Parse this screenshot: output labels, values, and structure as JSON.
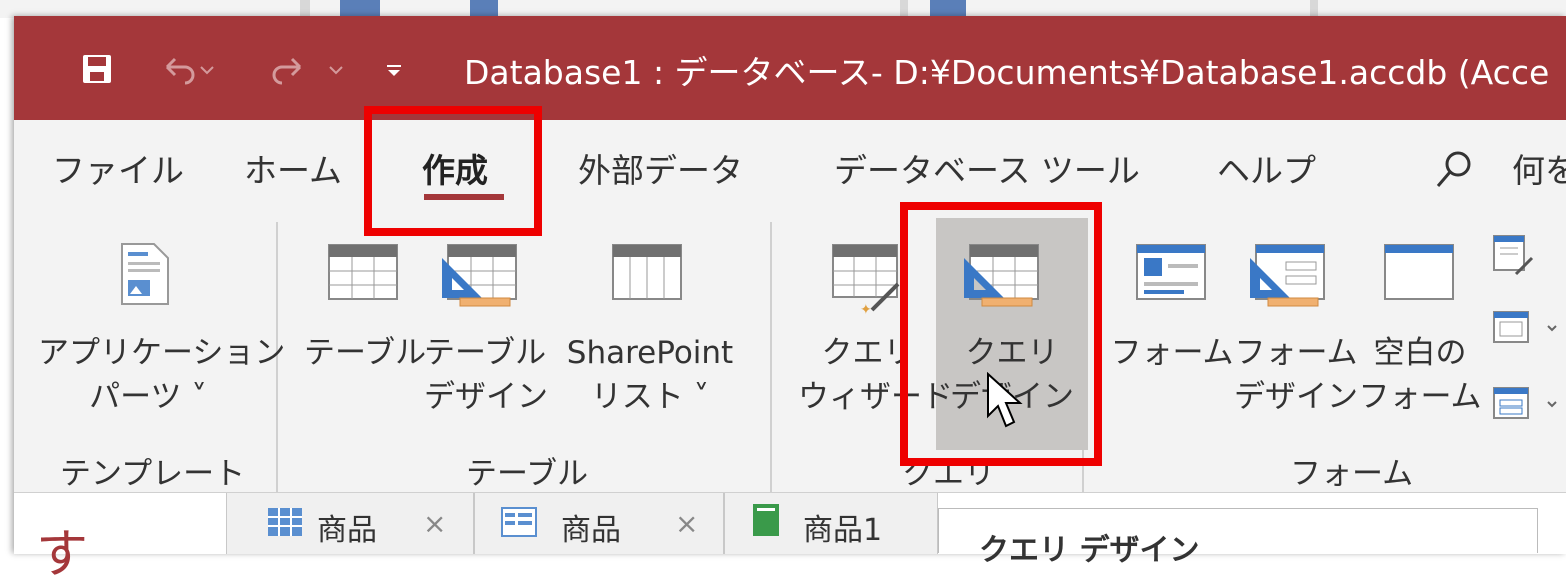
{
  "titlebar": {
    "title": "Database1 : データベース- D:¥Documents¥Database1.accdb (Acce",
    "color": "#a4373a"
  },
  "quick_access": [
    "save-icon",
    "undo-icon",
    "redo-icon",
    "customize-icon"
  ],
  "tabs": [
    {
      "label": "ファイル"
    },
    {
      "label": "ホーム"
    },
    {
      "label": "作成"
    },
    {
      "label": "外部データ"
    },
    {
      "label": "データベース ツール"
    },
    {
      "label": "ヘルプ"
    }
  ],
  "search": {
    "label": "何を"
  },
  "ribbon": {
    "template": {
      "app_parts": {
        "line1": "アプリケーション",
        "line2": "パーツ ˅"
      },
      "group": "テンプレート"
    },
    "table": {
      "table": {
        "line1": "テーブル"
      },
      "table_design": {
        "line1": "テーブル",
        "line2": "デザイン"
      },
      "sharepoint": {
        "line1": "SharePoint",
        "line2": "リスト ˅"
      },
      "group": "テーブル"
    },
    "query": {
      "wizard": {
        "line1": "クエリ",
        "line2": "ウィザード"
      },
      "design": {
        "line1": "クエリ",
        "line2": "デザイン"
      },
      "group": "クエリ"
    },
    "form": {
      "form": {
        "line1": "フォーム"
      },
      "form_design": {
        "line1": "フォーム",
        "line2": "デザイン"
      },
      "blank_form": {
        "line1": "空白の",
        "line2": "フォーム"
      },
      "group": "フォーム"
    }
  },
  "nav": {
    "glyph": "す"
  },
  "doc_tabs": [
    {
      "label": "商品",
      "close": "×"
    },
    {
      "label": "商品",
      "close": "×"
    },
    {
      "label": "商品1"
    }
  ],
  "tooltip": {
    "title": "クエリ デザイン"
  },
  "highlight_color": "#ee0000"
}
